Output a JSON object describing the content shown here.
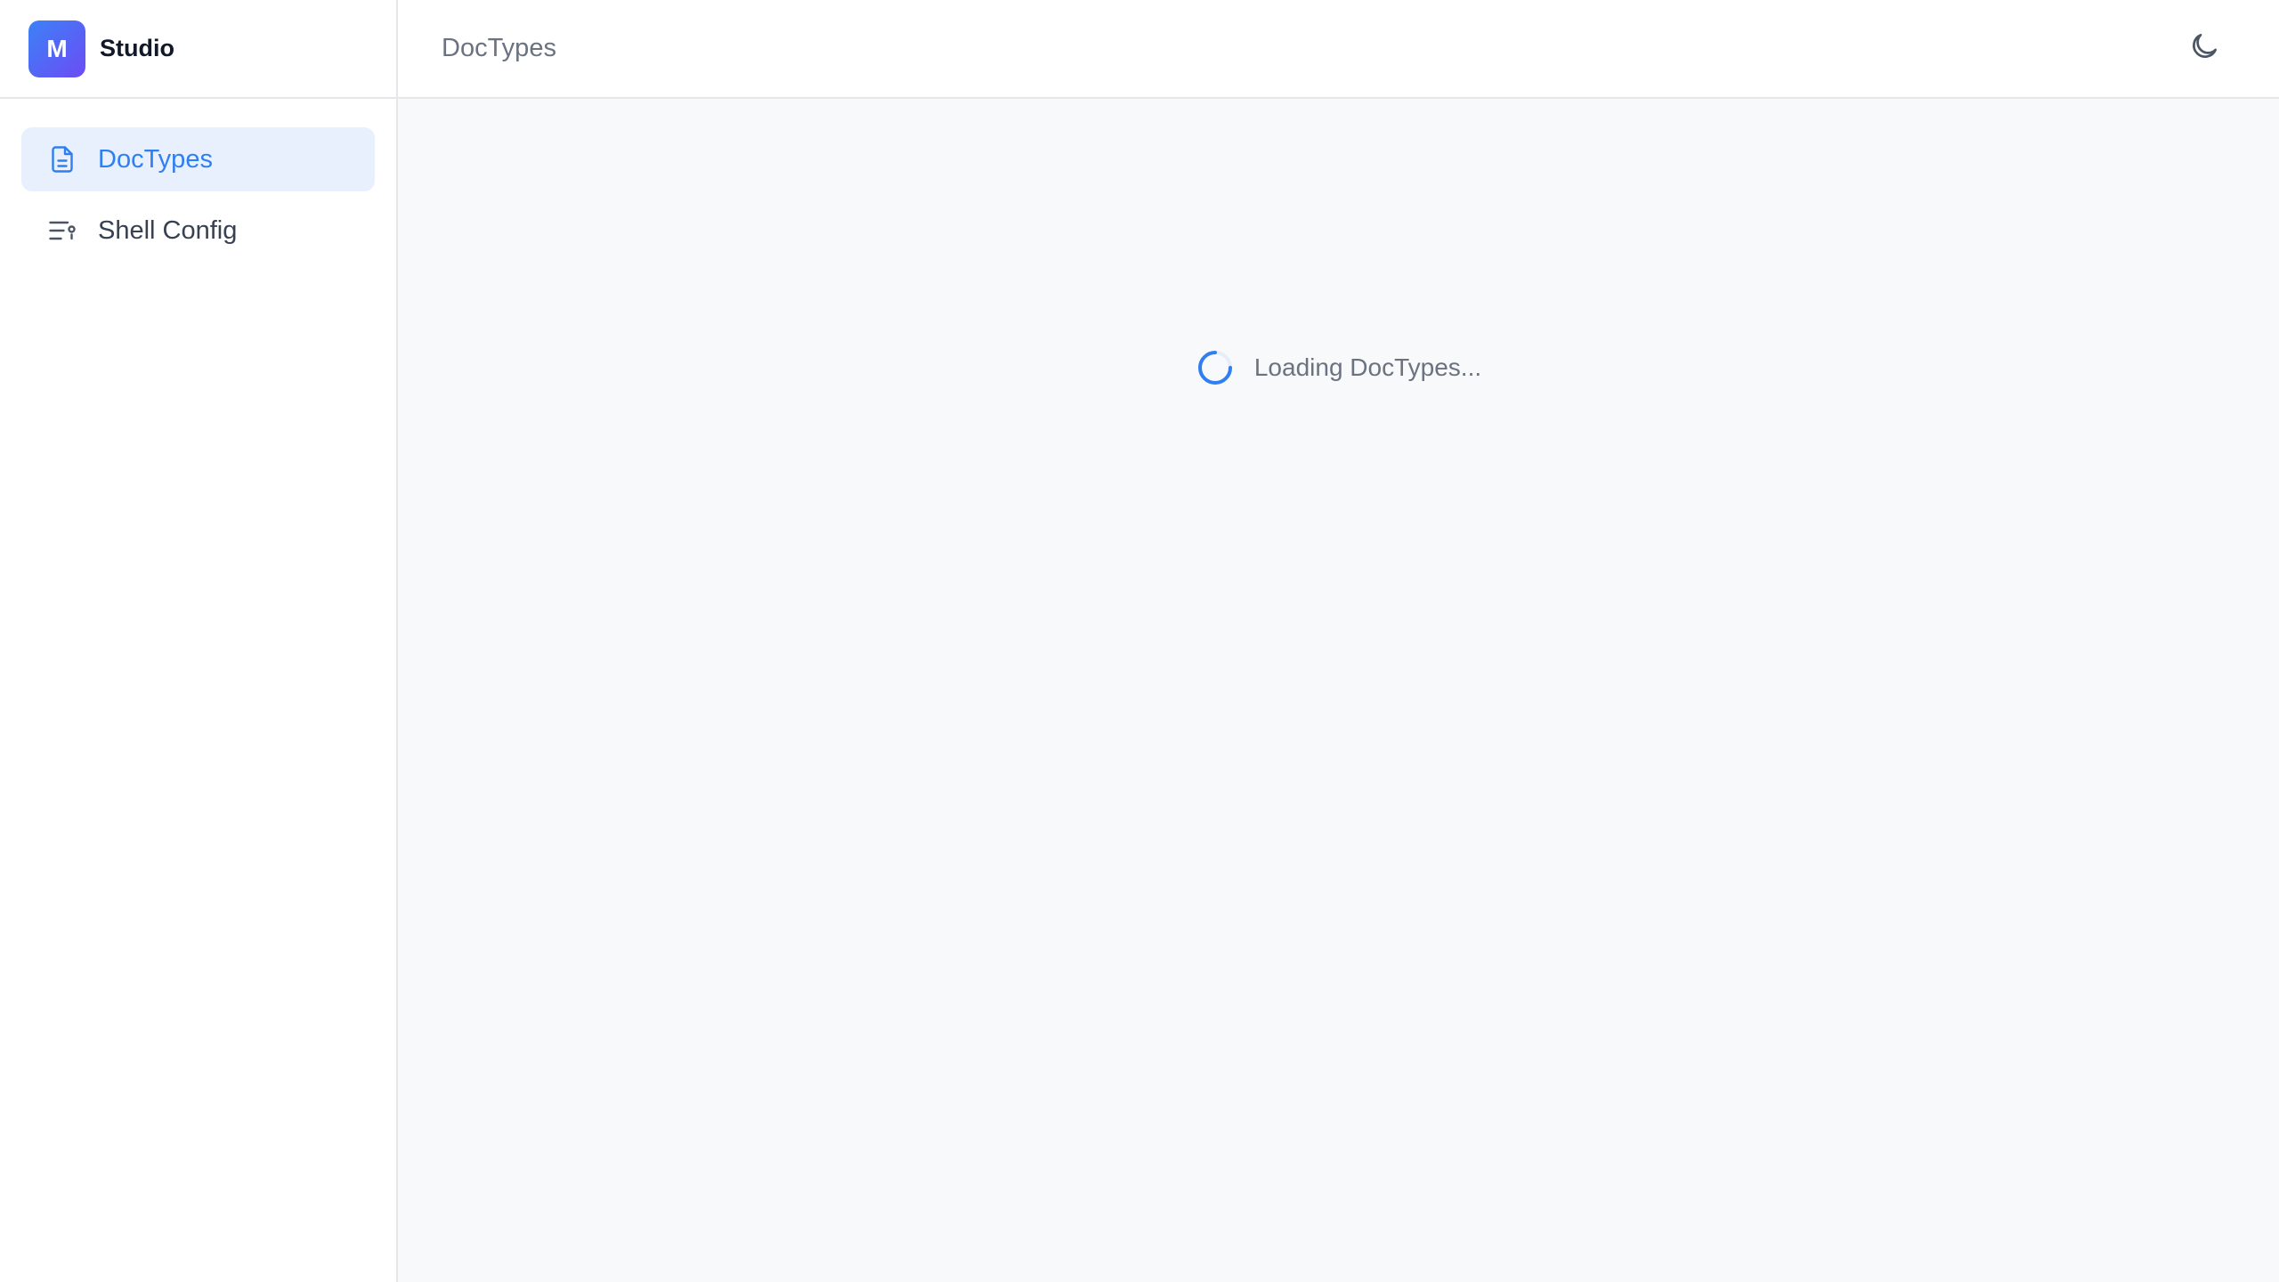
{
  "brand": {
    "logo_letter": "M",
    "name": "Studio"
  },
  "sidebar": {
    "items": [
      {
        "label": "DocTypes",
        "icon": "document-icon",
        "active": true
      },
      {
        "label": "Shell Config",
        "icon": "list-settings-icon",
        "active": false
      }
    ]
  },
  "header": {
    "title": "DocTypes",
    "theme_toggle_icon": "moon-icon"
  },
  "main": {
    "loading_text": "Loading DocTypes..."
  },
  "colors": {
    "accent": "#2f7ff0",
    "active_bg": "#e8f0fe",
    "logo_gradient_start": "#3b82f6",
    "logo_gradient_end": "#6d4bf5",
    "content_bg": "#f8f9fb"
  }
}
